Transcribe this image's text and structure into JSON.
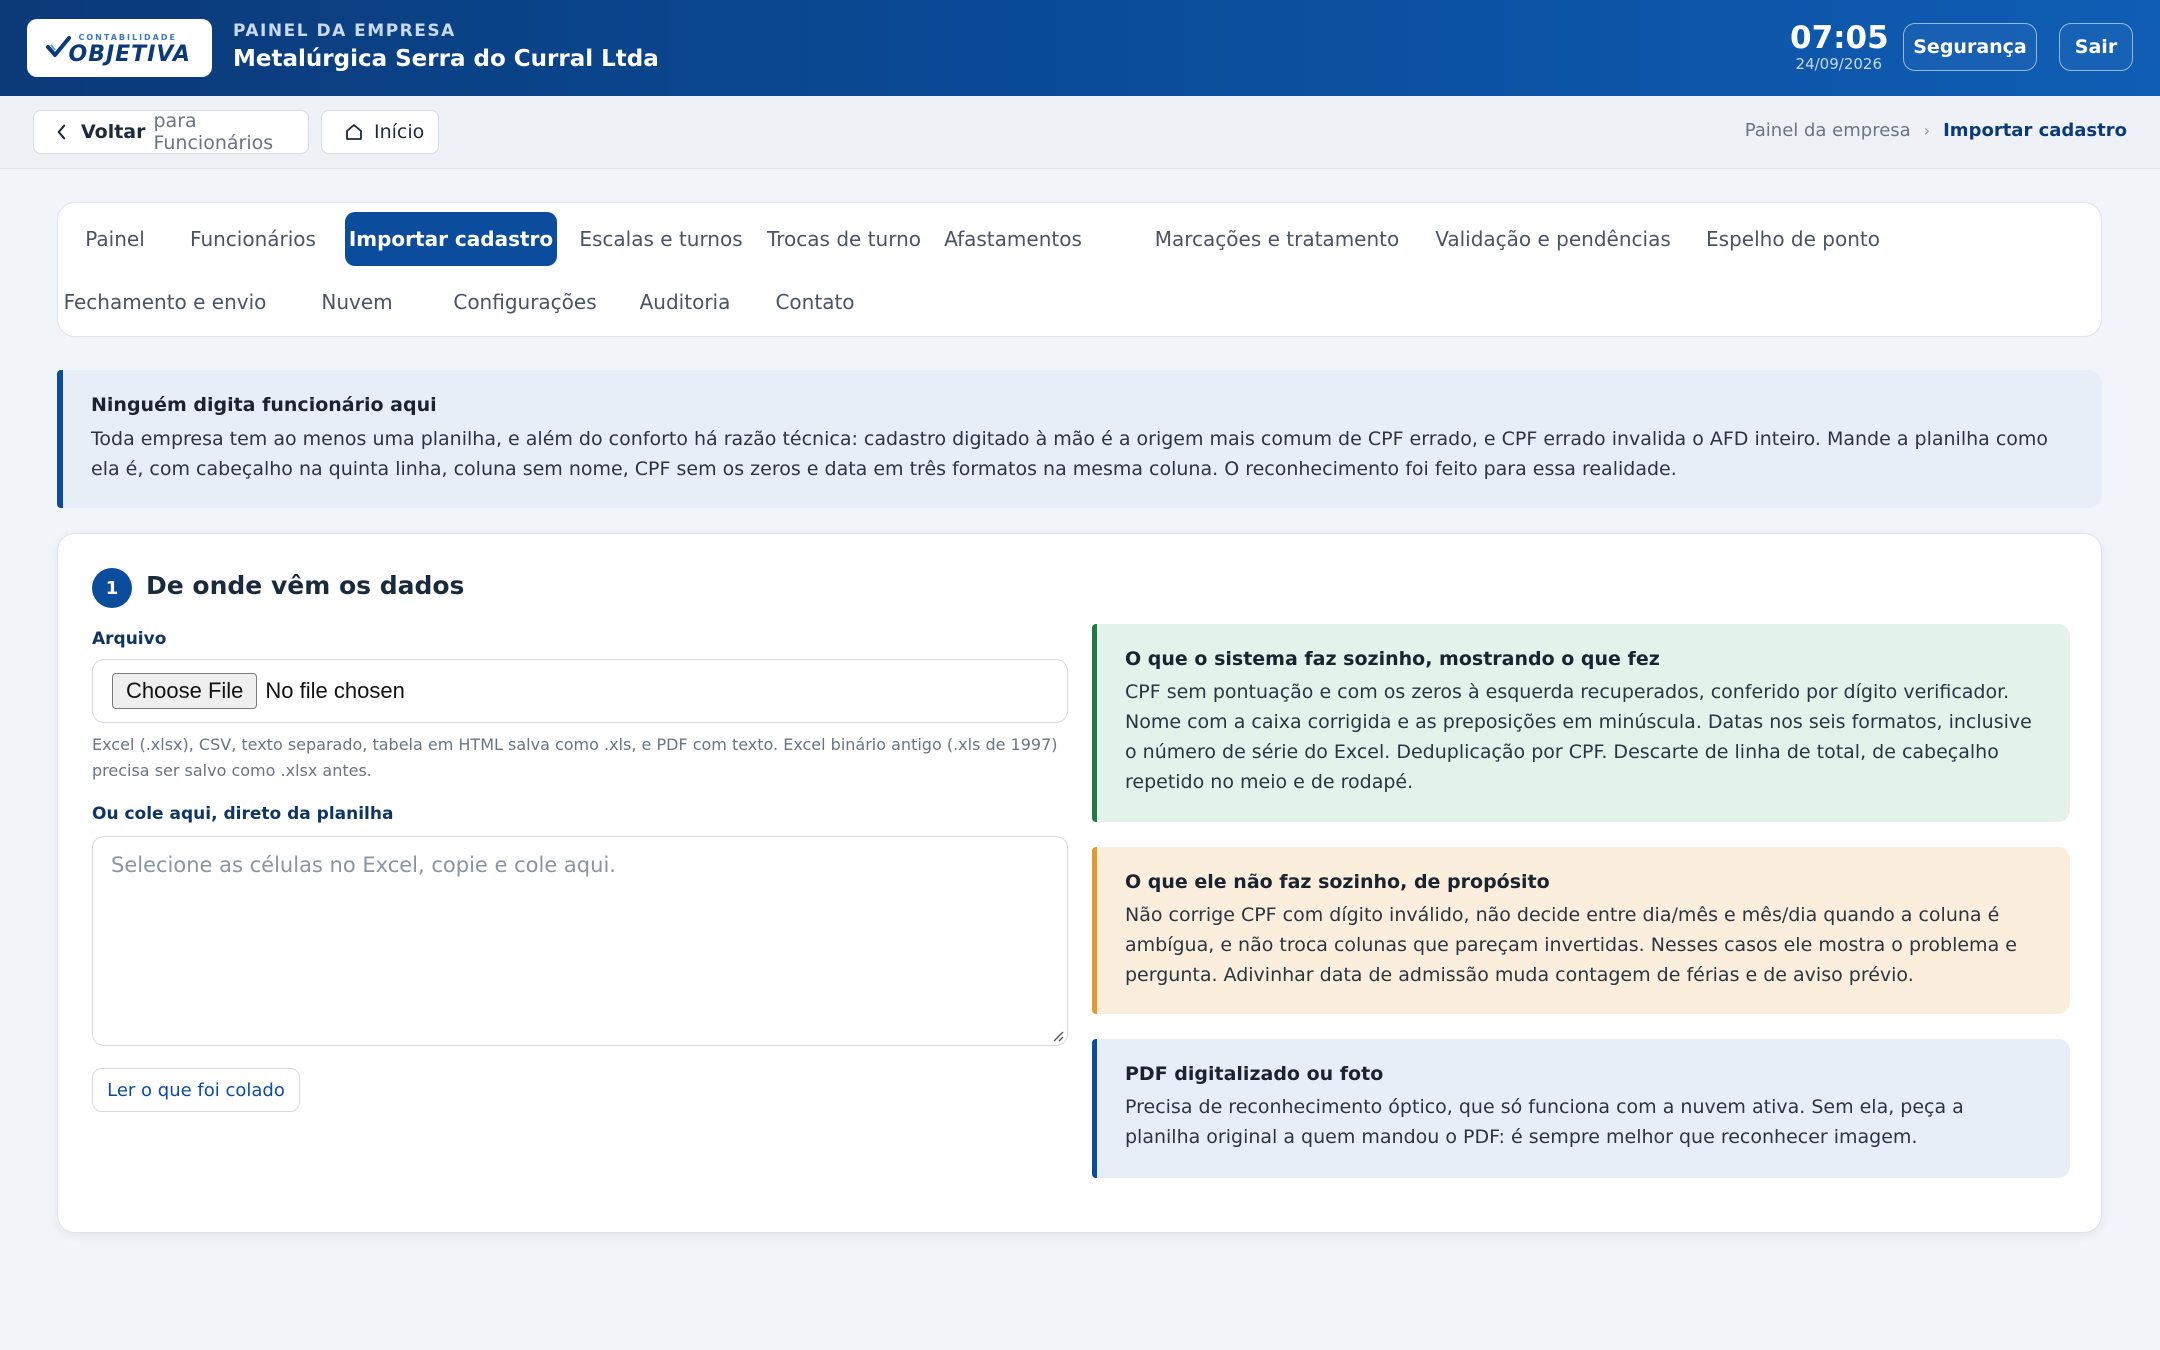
{
  "header": {
    "logo_small": "CONTABILIDADE",
    "logo_big": "OBJETIVA",
    "kicker": "PAINEL DA EMPRESA",
    "company": "Metalúrgica Serra do Curral Ltda",
    "time": "07:05",
    "date": "24/09/2026",
    "security_label": "Segurança",
    "logout_label": "Sair"
  },
  "subbar": {
    "back_label": "Voltar",
    "back_target": "para Funcionários",
    "home_label": "Início",
    "breadcrumb": [
      "Painel da empresa",
      "Importar cadastro"
    ]
  },
  "tabs": [
    {
      "label": "Painel"
    },
    {
      "label": "Funcionários"
    },
    {
      "label": "Importar cadastro",
      "active": true
    },
    {
      "label": "Escalas e turnos"
    },
    {
      "label": "Trocas de turno"
    },
    {
      "label": "Afastamentos"
    },
    {
      "label": "Marcações e tratamento"
    },
    {
      "label": "Validação e pendências"
    },
    {
      "label": "Espelho de ponto"
    },
    {
      "label": "Fechamento e envio"
    },
    {
      "label": "Nuvem"
    },
    {
      "label": "Configurações"
    },
    {
      "label": "Auditoria"
    },
    {
      "label": "Contato"
    }
  ],
  "intro": {
    "title": "Ninguém digita funcionário aqui",
    "text": "Toda empresa tem ao menos uma planilha, e além do conforto há razão técnica: cadastro digitado à mão é a origem mais comum de CPF errado, e CPF errado invalida o AFD inteiro. Mande a planilha como ela é, com cabeçalho na quinta linha, coluna sem nome, CPF sem os zeros e data em três formatos na mesma coluna. O reconhecimento foi feito para essa realidade."
  },
  "step": {
    "number": "1",
    "title": "De onde vêm os dados",
    "file_label": "Arquivo",
    "file_button": "Choose File",
    "file_status": "No file chosen",
    "file_help": "Excel (.xlsx), CSV, texto separado, tabela em HTML salva como .xls, e PDF com texto. Excel binário antigo (.xls de 1997) precisa ser salvo como .xlsx antes.",
    "paste_label": "Ou cole aqui, direto da planilha",
    "paste_placeholder": "Selecione as células no Excel, copie e cole aqui.",
    "read_button": "Ler o que foi colado"
  },
  "info": {
    "green": {
      "title": "O que o sistema faz sozinho, mostrando o que fez",
      "text": "CPF sem pontuação e com os zeros à esquerda recuperados, conferido por dígito verificador. Nome com a caixa corrigida e as preposições em minúscula. Datas nos seis formatos, inclusive o número de série do Excel. Deduplicação por CPF. Descarte de linha de total, de cabeçalho repetido no meio e de rodapé."
    },
    "orange": {
      "title": "O que ele não faz sozinho, de propósito",
      "text": "Não corrige CPF com dígito inválido, não decide entre dia/mês e mês/dia quando a coluna é ambígua, e não troca colunas que pareçam invertidas. Nesses casos ele mostra o problema e pergunta. Adivinhar data de admissão muda contagem de férias e de aviso prévio."
    },
    "blue": {
      "title": "PDF digitalizado ou foto",
      "text": "Precisa de reconhecimento óptico, que só funciona com a nuvem ativa. Sem ela, peça a planilha original a quem mandou o PDF: é sempre melhor que reconhecer imagem."
    }
  },
  "colors": {
    "brand": "#0b4c9c",
    "success": "#1f7a46",
    "warning": "#e29a31"
  }
}
